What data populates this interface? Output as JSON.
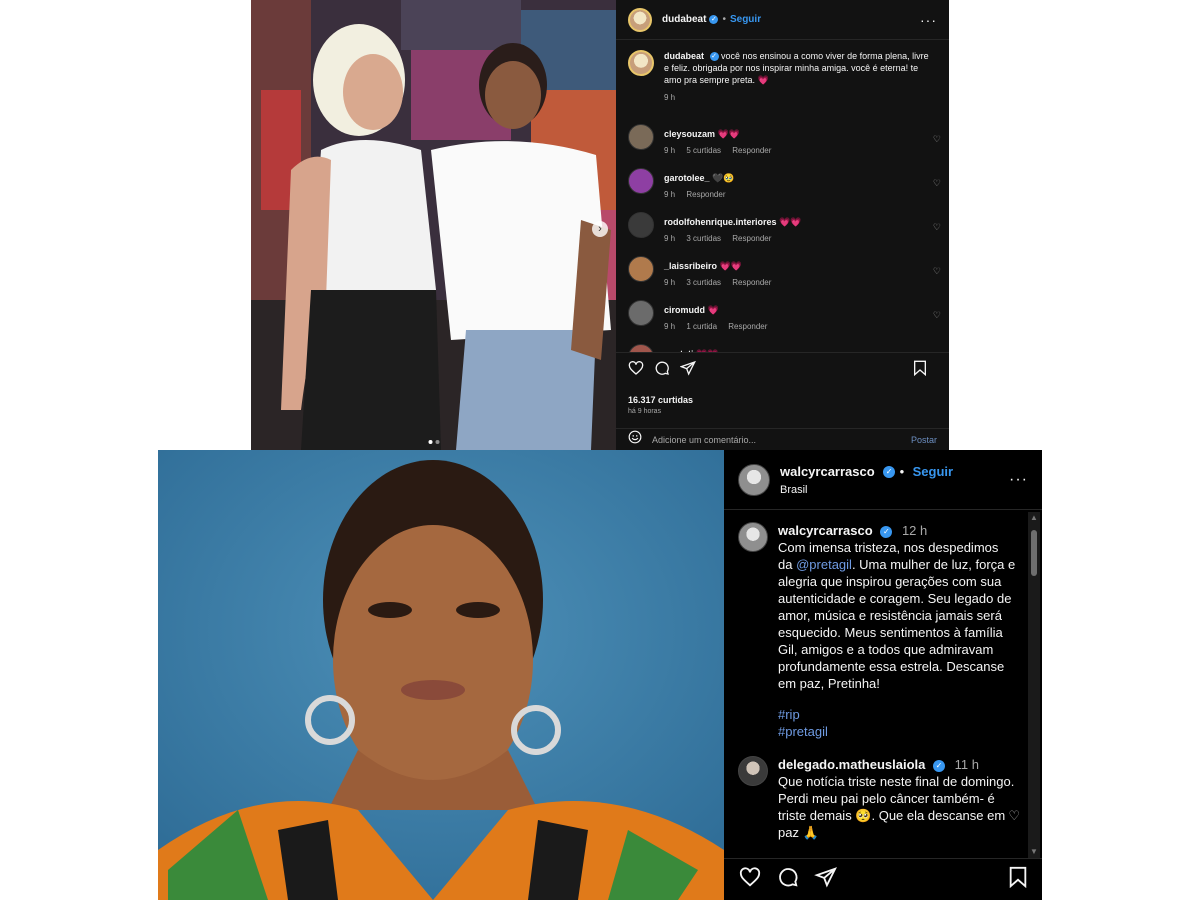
{
  "top_post": {
    "header": {
      "username": "dudabeat",
      "separator": "•",
      "follow_label": "Seguir",
      "more_icon": "more-options-icon"
    },
    "caption": {
      "username": "dudabeat",
      "text": "você nos ensinou a como viver de forma plena, livre e feliz. obrigada por nos inspirar minha amiga. você é eterna! te amo pra sempre preta. 💗",
      "time": "9 h"
    },
    "comments": [
      {
        "username": "cleysouzam",
        "text": "💗💗",
        "time": "9 h",
        "likes": "5 curtidas",
        "reply": "Responder",
        "avatar_color": "#7a6a58"
      },
      {
        "username": "garotolee_",
        "text": "🖤🥹",
        "time": "9 h",
        "likes": "",
        "reply": "Responder",
        "avatar_color": "#8e3fa3"
      },
      {
        "username": "rodolfohenrique.interiores",
        "text": "💗💗",
        "time": "9 h",
        "likes": "3 curtidas",
        "reply": "Responder",
        "avatar_color": "#3a3a3a"
      },
      {
        "username": "_laissribeiro",
        "text": "💗💗",
        "time": "9 h",
        "likes": "3 curtidas",
        "reply": "Responder",
        "avatar_color": "#b07a4c"
      },
      {
        "username": "ciromudd",
        "text": "💗",
        "time": "9 h",
        "likes": "1 curtida",
        "reply": "Responder",
        "avatar_color": "#6b6b6b"
      },
      {
        "username": "opstati",
        "text": "💗💗",
        "time": "",
        "likes": "",
        "reply": "",
        "avatar_color": "#a0564c"
      }
    ],
    "likes": "16.317 curtidas",
    "posted_ago": "há 9 horas",
    "add_comment_placeholder": "Adicione um comentário...",
    "post_label": "Postar"
  },
  "bottom_post": {
    "header": {
      "username": "walcyrcarrasco",
      "follow_label": "Seguir",
      "location": "Brasil"
    },
    "caption": {
      "username": "walcyrcarrasco",
      "time": "12 h",
      "text_before": "Com imensa tristeza, nos despedimos da",
      "mention": "@pretagil",
      "text_after": ". Uma mulher de luz, força e alegria que inspirou gerações com sua autenticidade e coragem. Seu legado de amor, música e resistência jamais será esquecido. Meus sentimentos à família Gil, amigos e a todos que admiravam profundamente essa estrela. Descanse em paz, Pretinha!",
      "tags": [
        "#rip",
        "#pretagil"
      ]
    },
    "comment": {
      "username": "delegado.matheuslaiola",
      "time": "11 h",
      "text": "Que notícia triste neste final de domingo. Perdi meu pai pelo câncer também- é triste demais 🥺. Que ela descanse em paz 🙏"
    }
  },
  "colors": {
    "accent_blue": "#3897f0",
    "heart_red": "#ed4956",
    "dark_bg": "#121212"
  }
}
